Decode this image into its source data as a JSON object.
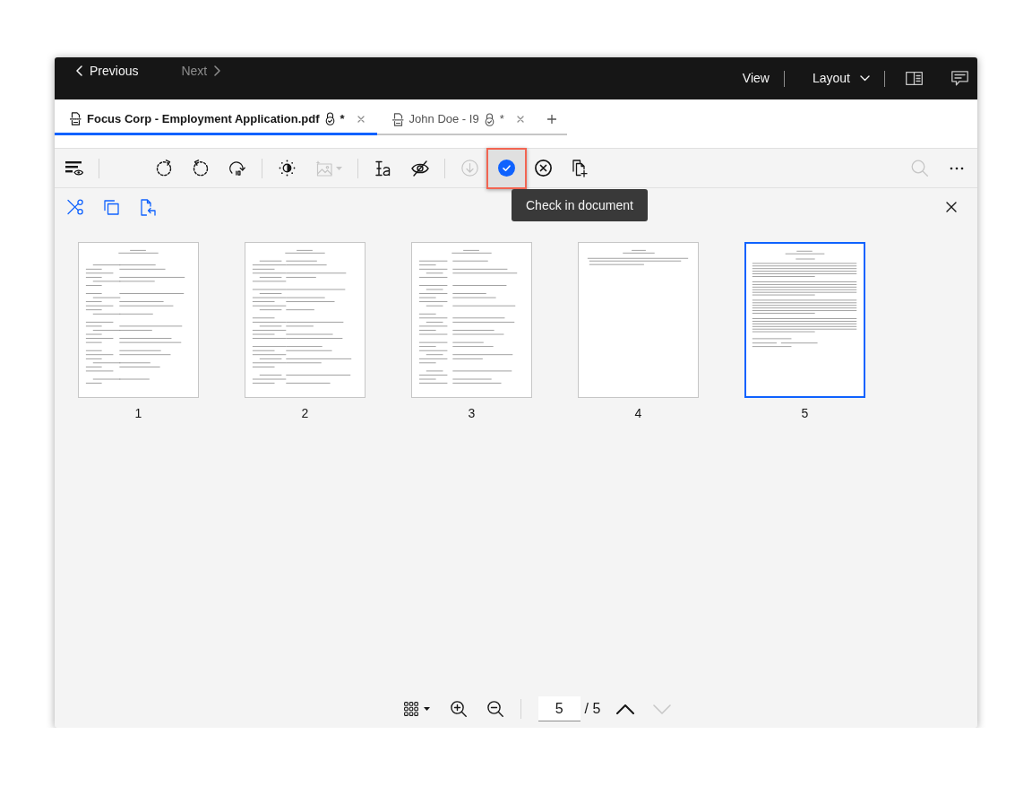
{
  "header": {
    "previous": {
      "label": "Previous",
      "disabled": false
    },
    "next": {
      "label": "Next",
      "disabled": true
    },
    "menus": [
      {
        "label": "View",
        "kind": "plain"
      },
      {
        "label": "Layout",
        "kind": "dropdown"
      }
    ]
  },
  "tabs": [
    {
      "title": "Focus Corp - Employment Application.pdf",
      "modified_mark": "*",
      "selected": true
    },
    {
      "title": "John Doe - I9",
      "modified_mark": "*",
      "selected": false
    }
  ],
  "toolbar": {
    "groups": [
      [
        {
          "kind": "button",
          "disabled": false,
          "highlighted": false
        }
      ],
      [
        {
          "kind": "button",
          "disabled": false,
          "highlighted": false
        },
        {
          "kind": "button",
          "disabled": false,
          "highlighted": false
        },
        {
          "kind": "button",
          "disabled": false,
          "highlighted": false
        }
      ],
      [
        {
          "kind": "button",
          "disabled": false,
          "highlighted": false
        },
        {
          "kind": "dropdown",
          "disabled": true,
          "highlighted": false
        }
      ],
      [
        {
          "kind": "button",
          "disabled": false,
          "highlighted": false
        },
        {
          "kind": "button",
          "disabled": false,
          "highlighted": false
        }
      ],
      [
        {
          "kind": "button",
          "disabled": true,
          "highlighted": false
        },
        {
          "kind": "button",
          "disabled": false,
          "highlighted": true
        },
        {
          "kind": "button",
          "disabled": false,
          "highlighted": false
        },
        {
          "kind": "button",
          "disabled": false,
          "highlighted": false
        }
      ]
    ],
    "right": [
      {
        "kind": "button",
        "disabled": true,
        "highlighted": false
      },
      {
        "kind": "button",
        "disabled": false,
        "highlighted": false
      }
    ],
    "tooltip": "Check in document"
  },
  "pages": [
    {
      "label": "1",
      "selected": false
    },
    {
      "label": "2",
      "selected": false
    },
    {
      "label": "3",
      "selected": false
    },
    {
      "label": "4",
      "selected": false
    },
    {
      "label": "5",
      "selected": true
    }
  ],
  "pager": {
    "page_input": "5",
    "total": "/ 5",
    "previous_page": {
      "disabled": false
    },
    "next_page": {
      "disabled": true
    }
  }
}
